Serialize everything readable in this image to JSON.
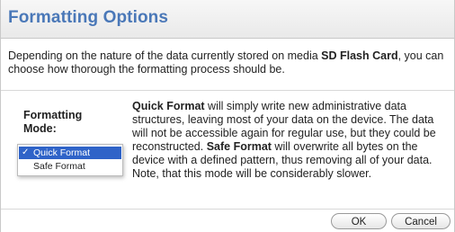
{
  "dialog": {
    "title": "Formatting Options"
  },
  "intro": {
    "part1": "Depending on the nature of the data currently stored on media ",
    "media": "SD Flash Card",
    "part2": ", you can choose how thorough the formatting process should be."
  },
  "mode": {
    "label": "Formatting Mode:",
    "options": [
      {
        "label": "Quick Format",
        "selected": true,
        "check": "✓"
      },
      {
        "label": "Safe Format",
        "selected": false,
        "check": ""
      }
    ]
  },
  "description": {
    "quick_title": "Quick Format",
    "quick_text": " will simply write new administrative data structures, leaving most of your data on the device. The data will not be accessible again for regular use, but they could be reconstructed. ",
    "safe_title": "Safe Format",
    "safe_text": " will overwrite all bytes on the device with a defined pattern, thus removing all of your data. Note, that this mode will be considerably slower."
  },
  "buttons": {
    "ok": "OK",
    "cancel": "Cancel"
  },
  "colors": {
    "title": "#4a78b8",
    "selection": "#2f63c8"
  }
}
